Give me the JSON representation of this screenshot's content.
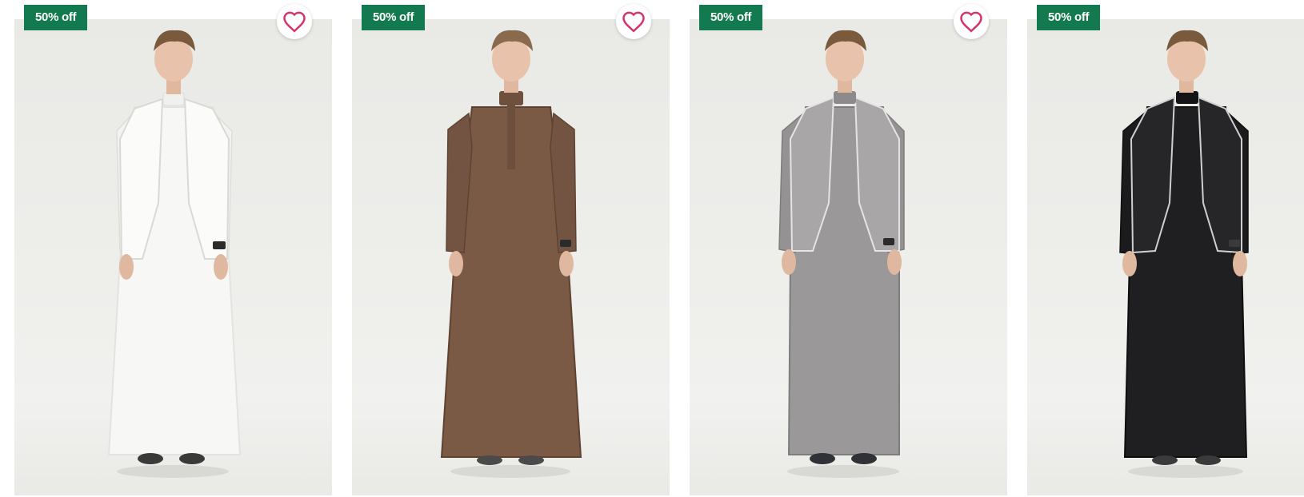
{
  "products": [
    {
      "badge": "50% off",
      "image_alt": "White thobe with white vest",
      "colors": {
        "robe": "#f7f7f5",
        "robe_shade": "#e3e3e0",
        "vest": "#fbfbfa",
        "vest_trim": "#d9d9d6"
      }
    },
    {
      "badge": "50% off",
      "image_alt": "Brown thobe",
      "colors": {
        "robe": "#7a5a45",
        "robe_shade": "#5e4333",
        "vest": "",
        "vest_trim": ""
      }
    },
    {
      "badge": "50% off",
      "image_alt": "Grey thobe with grey vest",
      "colors": {
        "robe": "#9b9899",
        "robe_shade": "#7f7c7d",
        "vest": "#a9a6a7",
        "vest_trim": "#e4e4e4"
      }
    },
    {
      "badge": "50% off",
      "image_alt": "Black thobe with black vest",
      "colors": {
        "robe": "#1f1f21",
        "robe_shade": "#0f0f10",
        "vest": "#262628",
        "vest_trim": "#cfcfcf"
      }
    }
  ],
  "theme": {
    "badge_bg": "#137a4f",
    "heart_color": "#d6336c"
  },
  "icons": {
    "wishlist": "heart-outline-icon"
  }
}
